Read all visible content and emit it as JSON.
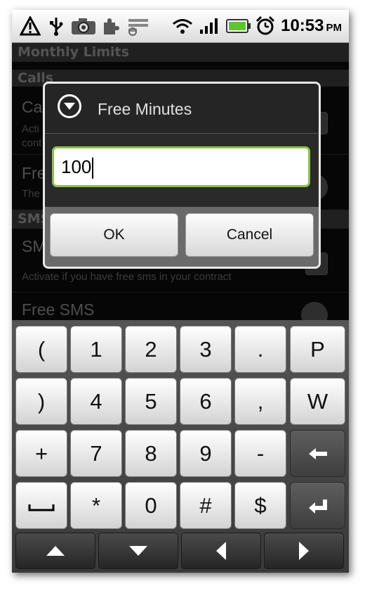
{
  "status_bar": {
    "time": "10:53",
    "ampm": "PM",
    "icons": [
      "warning-icon",
      "usb-icon",
      "camera-icon",
      "puzzle-icon",
      "sync-icon",
      "wifi-icon",
      "signal-icon",
      "battery-icon",
      "alarm-icon"
    ]
  },
  "background": {
    "section_title": "Monthly Limits",
    "calls_header": "Calls",
    "calls_row_title": "Ca",
    "calls_row_sub1": "Acti",
    "calls_row_sub2": "cont",
    "free_minutes_title": "Fre",
    "free_minutes_sub": "The",
    "sms_header": "SMS",
    "sms_row_title": "SM",
    "sms_row_sub": "Activate if you have free sms in your contract",
    "free_sms_title": "Free SMS"
  },
  "dialog": {
    "title": "Free Minutes",
    "value": "100",
    "ok_label": "OK",
    "cancel_label": "Cancel"
  },
  "keyboard": {
    "row1": [
      "(",
      "1",
      "2",
      "3",
      ".",
      "P"
    ],
    "row2": [
      ")",
      "4",
      "5",
      "6",
      ",",
      "W"
    ],
    "row3": [
      "+",
      "7",
      "8",
      "9",
      "-"
    ],
    "row4": [
      "*",
      "0",
      "#",
      "$"
    ]
  },
  "colors": {
    "input_border": "#8bc34a",
    "status_bar": "#e8e8e8",
    "battery": "#5ec62d"
  }
}
